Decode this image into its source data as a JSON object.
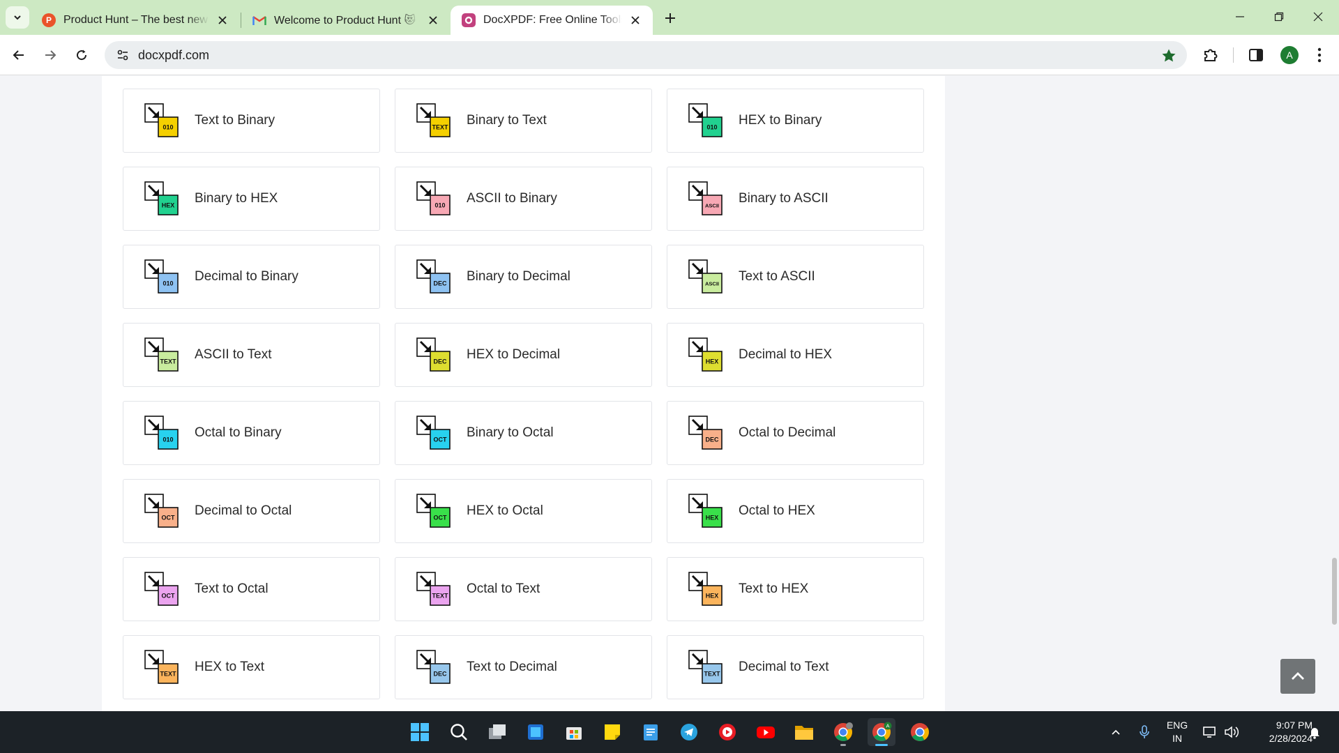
{
  "browser": {
    "tabs": [
      {
        "title": "Product Hunt – The best new products in tech.",
        "favicon": "product-hunt-icon",
        "active": false
      },
      {
        "title": "Welcome to Product Hunt 😻 - Gmail",
        "favicon": "gmail-icon",
        "active": false
      },
      {
        "title": "DocXPDF: Free Online Tools • Fast",
        "favicon": "docxpdf-icon",
        "active": true
      }
    ],
    "url": "docxpdf.com",
    "profile_initial": "A",
    "accent_color": "#cde9c3"
  },
  "tools": [
    {
      "label": "Text to Binary",
      "badge": "010",
      "color": "#f5d000"
    },
    {
      "label": "Binary to Text",
      "badge": "TEXT",
      "color": "#f5d000"
    },
    {
      "label": "HEX to Binary",
      "badge": "010",
      "color": "#21d18f"
    },
    {
      "label": "Binary to HEX",
      "badge": "HEX",
      "color": "#21d18f"
    },
    {
      "label": "ASCII to Binary",
      "badge": "010",
      "color": "#f7a8b4"
    },
    {
      "label": "Binary to ASCII",
      "badge": "ASCII",
      "color": "#f7a8b4"
    },
    {
      "label": "Decimal to Binary",
      "badge": "010",
      "color": "#8ec2f2"
    },
    {
      "label": "Binary to Decimal",
      "badge": "DEC",
      "color": "#8ec2f2"
    },
    {
      "label": "Text to ASCII",
      "badge": "ASCII",
      "color": "#c9ec9e"
    },
    {
      "label": "ASCII to Text",
      "badge": "TEXT",
      "color": "#c9ec9e"
    },
    {
      "label": "HEX to Decimal",
      "badge": "DEC",
      "color": "#dede30"
    },
    {
      "label": "Decimal to HEX",
      "badge": "HEX",
      "color": "#dede30"
    },
    {
      "label": "Octal to Binary",
      "badge": "010",
      "color": "#28d2ef"
    },
    {
      "label": "Binary to Octal",
      "badge": "OCT",
      "color": "#28d2ef"
    },
    {
      "label": "Octal to Decimal",
      "badge": "DEC",
      "color": "#f8b08a"
    },
    {
      "label": "Decimal to Octal",
      "badge": "OCT",
      "color": "#f8b08a"
    },
    {
      "label": "HEX to Octal",
      "badge": "OCT",
      "color": "#39e04a"
    },
    {
      "label": "Octal to HEX",
      "badge": "HEX",
      "color": "#39e04a"
    },
    {
      "label": "Text to Octal",
      "badge": "OCT",
      "color": "#eba4ef"
    },
    {
      "label": "Octal to Text",
      "badge": "TEXT",
      "color": "#eba4ef"
    },
    {
      "label": "Text to HEX",
      "badge": "HEX",
      "color": "#fbb45c"
    },
    {
      "label": "HEX to Text",
      "badge": "TEXT",
      "color": "#fbb45c"
    },
    {
      "label": "Text to Decimal",
      "badge": "DEC",
      "color": "#97c7ec"
    },
    {
      "label": "Decimal to Text",
      "badge": "TEXT",
      "color": "#97c7ec"
    }
  ],
  "taskbar": {
    "apps": [
      {
        "name": "start-icon",
        "running": false
      },
      {
        "name": "search-icon",
        "running": false
      },
      {
        "name": "task-view-icon",
        "running": false
      },
      {
        "name": "widgets-icon",
        "running": false
      },
      {
        "name": "microsoft-store-icon",
        "running": false
      },
      {
        "name": "sticky-notes-icon",
        "running": false
      },
      {
        "name": "notepad-icon",
        "running": false
      },
      {
        "name": "telegram-icon",
        "running": false
      },
      {
        "name": "media-player-icon",
        "running": false
      },
      {
        "name": "youtube-icon",
        "running": false
      },
      {
        "name": "file-explorer-icon",
        "running": false
      },
      {
        "name": "chrome-icon",
        "running": true
      },
      {
        "name": "chrome-profile-a-icon",
        "running": true
      },
      {
        "name": "chrome-alt-icon",
        "running": false
      }
    ],
    "language_line1": "ENG",
    "language_line2": "IN",
    "time": "9:07 PM",
    "date": "2/28/2024"
  }
}
